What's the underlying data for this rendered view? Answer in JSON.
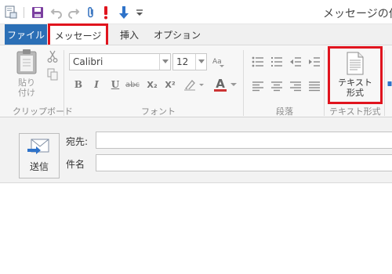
{
  "window": {
    "title": "メッセージの作成"
  },
  "tabs": {
    "file": "ファイル",
    "message": "メッセージ",
    "insert": "挿入",
    "options": "オプション"
  },
  "clipboard": {
    "paste_label_line1": "貼り",
    "paste_label_line2": "付け",
    "group_label": "クリップボード"
  },
  "font": {
    "family": "Calibri",
    "size": "12",
    "group_label": "フォント",
    "bold": "B",
    "italic": "I",
    "underline": "U",
    "strike": "abc",
    "subscript": "X₂",
    "superscript": "X²",
    "font_color_glyph": "A"
  },
  "paragraph": {
    "group_label": "段落"
  },
  "text_format": {
    "button_line1": "テキスト",
    "button_line2": "形式",
    "group_label": "テキスト形式"
  },
  "compose": {
    "send_label": "送信",
    "to_label": "宛先:",
    "subject_label": "件名",
    "to_value": "",
    "subject_value": ""
  },
  "colors": {
    "file_tab": "#2b6fb6",
    "highlight": "#e0141e",
    "accent_blue": "#2f73c9"
  }
}
